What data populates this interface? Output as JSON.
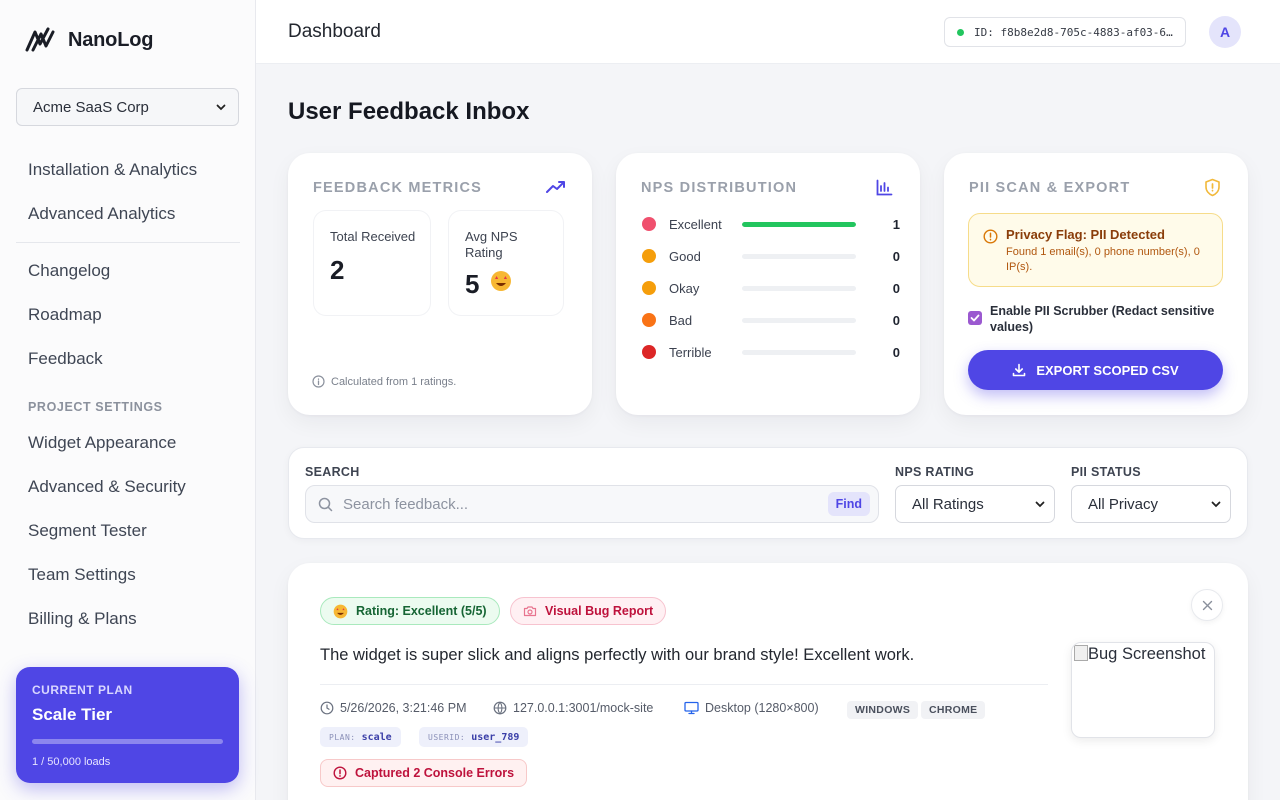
{
  "sidebar": {
    "brand": "NanoLog",
    "org_select": "Acme SaaS Corp",
    "items_primary": [
      "Installation & Analytics",
      "Advanced Analytics"
    ],
    "items_secondary": [
      "Changelog",
      "Roadmap",
      "Feedback"
    ],
    "section_title": "PROJECT SETTINGS",
    "items_settings": [
      "Widget Appearance",
      "Advanced & Security",
      "Segment Tester",
      "Team Settings",
      "Billing & Plans"
    ],
    "plan": {
      "label": "CURRENT PLAN",
      "name": "Scale Tier",
      "usage_fraction": 2e-05,
      "loads": "1 / 50,000 loads"
    }
  },
  "header": {
    "title": "Dashboard",
    "project_id": "ID: f8b8e2d8-705c-4883-af03-6...",
    "status_color": "#22c55e",
    "avatar": "A"
  },
  "page": {
    "title": "User Feedback Inbox"
  },
  "metrics": {
    "title": "FEEDBACK METRICS",
    "icon": "trending-up-icon",
    "total_label": "Total Received",
    "total_value": "2",
    "avg_label": "Avg NPS Rating",
    "avg_value": "5",
    "avg_emoji": "star-struck-emoji",
    "note": "Calculated from 1 ratings."
  },
  "nps": {
    "title": "NPS DISTRIBUTION",
    "icon": "bar-chart-icon",
    "rows": [
      {
        "label": "Excellent",
        "count": "1",
        "fraction": 1,
        "emoji_color": "#f0506e"
      },
      {
        "label": "Good",
        "count": "0",
        "fraction": 0,
        "emoji_color": "#f59e0b"
      },
      {
        "label": "Okay",
        "count": "0",
        "fraction": 0,
        "emoji_color": "#f59e0b"
      },
      {
        "label": "Bad",
        "count": "0",
        "fraction": 0,
        "emoji_color": "#f97316"
      },
      {
        "label": "Terrible",
        "count": "0",
        "fraction": 0,
        "emoji_color": "#dc2626"
      }
    ]
  },
  "pii": {
    "title": "PII SCAN & EXPORT",
    "icon": "shield-alert-icon",
    "alert_title": "Privacy Flag: PII Detected",
    "alert_body": "Found 1 email(s), 0 phone number(s), 0 IP(s).",
    "checkbox_label": "Enable PII Scrubber (Redact sensitive values)",
    "checkbox_checked": true,
    "export_label": "EXPORT SCOPED CSV"
  },
  "filters": {
    "search_label": "SEARCH",
    "search_placeholder": "Search feedback...",
    "find_label": "Find",
    "nps_label": "NPS RATING",
    "nps_value": "All Ratings",
    "pii_label": "PII STATUS",
    "pii_value": "All Privacy"
  },
  "feedback": {
    "rating_pill": "Rating: Excellent (5/5)",
    "bug_pill": "Visual Bug Report",
    "text": "The widget is super slick and aligns perfectly with our brand style! Excellent work.",
    "timestamp": "5/26/2026, 3:21:46 PM",
    "url": "127.0.0.1:3001/mock-site",
    "device": "Desktop (1280×800)",
    "os": "WINDOWS",
    "browser": "CHROME",
    "plan_key": "PLAN:",
    "plan_value": "scale",
    "userid_key": "USERID:",
    "userid_value": "user_789",
    "console_errors": "Captured 2 Console Errors",
    "screenshot_alt": "Bug Screenshot"
  },
  "colors": {
    "accent": "#4f46e5",
    "success": "#22c55e",
    "danger": "#be123c"
  }
}
